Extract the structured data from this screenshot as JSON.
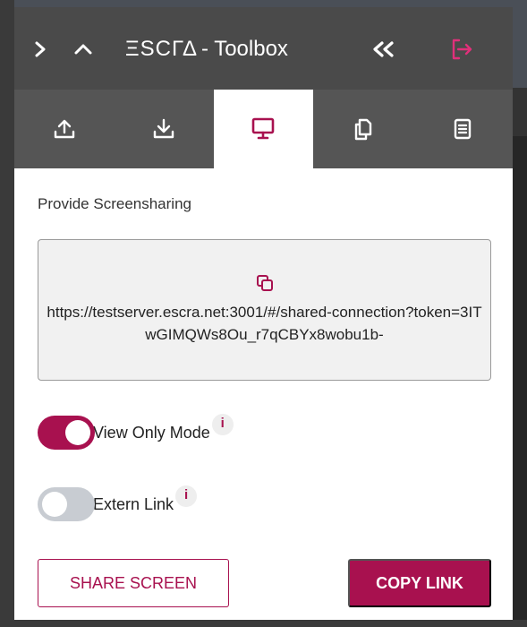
{
  "header": {
    "brand_logo": "ΞSCΓΔ",
    "brand_title": "- Toolbox"
  },
  "icons": {
    "expand": "chevron-right-icon",
    "collapse": "chevron-up-icon",
    "double_chevron": "double-chevron-left-icon",
    "logout": "logout-icon"
  },
  "tabs": [
    {
      "name": "upload-icon",
      "active": false
    },
    {
      "name": "download-icon",
      "active": false
    },
    {
      "name": "monitor-icon",
      "active": true
    },
    {
      "name": "copy-documents-icon",
      "active": false
    },
    {
      "name": "notes-icon",
      "active": false
    }
  ],
  "content": {
    "section_title": "Provide Screensharing",
    "link": "https://testserver.escra.net:3001/#/shared-connection?token=3ITwGIMQWs8Ou_r7qCBYx8wobu1b-",
    "toggles": [
      {
        "label": "View Only Mode",
        "on": true,
        "info": "i"
      },
      {
        "label": "Extern Link",
        "on": false,
        "info": "i"
      }
    ],
    "share_button": "SHARE SCREEN",
    "copy_button": "COPY LINK"
  },
  "colors": {
    "accent": "#a8114f",
    "header_bg": "#4a4a4a",
    "tabs_bg": "#555555",
    "logout_icon": "#e0307a"
  }
}
